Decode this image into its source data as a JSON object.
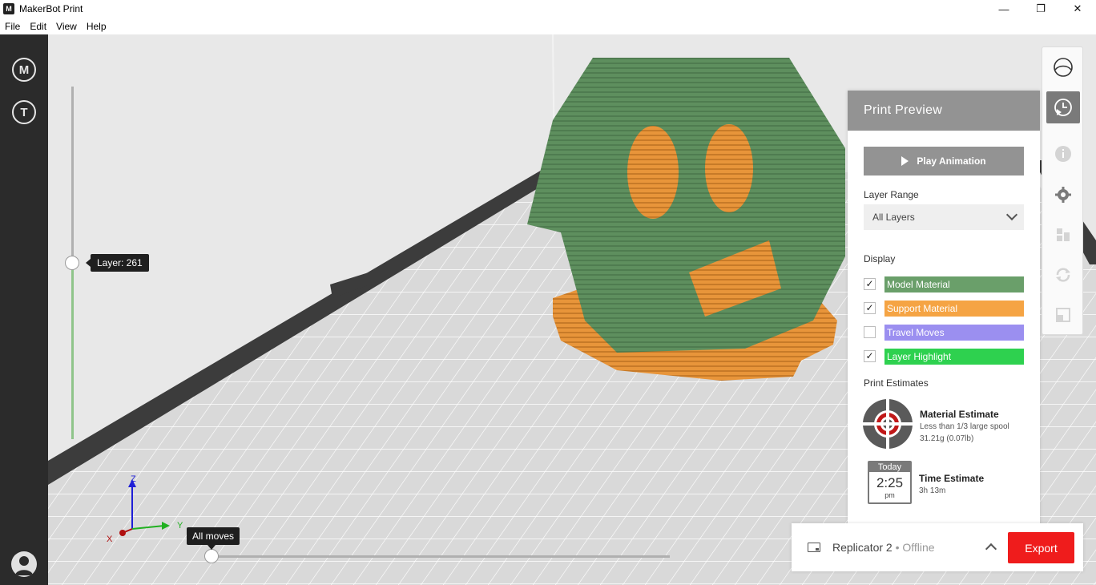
{
  "window": {
    "title": "MakerBot Print",
    "minimize": "—",
    "maximize": "❐",
    "close": "✕"
  },
  "menu": [
    "File",
    "Edit",
    "View",
    "Help"
  ],
  "leftbar": {
    "logo_glyph": "M",
    "thingiverse_glyph": "T"
  },
  "viewport": {
    "layer_label": "Layer: 261",
    "moves_label": "All moves",
    "axes": {
      "x": "X",
      "y": "Y",
      "z": "Z"
    }
  },
  "right_toolbar": {
    "items": [
      "globe-icon",
      "print-preview-icon",
      "info-icon",
      "settings-icon",
      "arrange-icon",
      "rotate-icon",
      "scale-icon"
    ]
  },
  "panel": {
    "title": "Print Preview",
    "play_label": "Play Animation",
    "layer_range_label": "Layer Range",
    "layer_range_value": "All Layers",
    "display_label": "Display",
    "display": [
      {
        "label": "Model Material",
        "checked": true,
        "color": "#6a9f6a"
      },
      {
        "label": "Support Material",
        "checked": true,
        "color": "#f5a444"
      },
      {
        "label": "Travel Moves",
        "checked": false,
        "color": "#9b8ff0"
      },
      {
        "label": "Layer Highlight",
        "checked": true,
        "color": "#2ed14f"
      }
    ],
    "estimates_label": "Print Estimates",
    "material": {
      "title": "Material Estimate",
      "line1": "Less than 1/3 large spool",
      "line2": "31.21g (0.07lb)"
    },
    "time": {
      "cal_day": "Today",
      "cal_time": "2:25",
      "cal_ampm": "pm",
      "title": "Time Estimate",
      "value": "3h 13m"
    }
  },
  "bottom": {
    "printer": "Replicator 2",
    "status": "• Offline",
    "export_label": "Export"
  },
  "colors": {
    "accent": "#ef1c1c",
    "panel_gray": "#939393",
    "model": "#5e8f5e",
    "support": "#e8953a",
    "sidebar": "#2b2b2b"
  }
}
